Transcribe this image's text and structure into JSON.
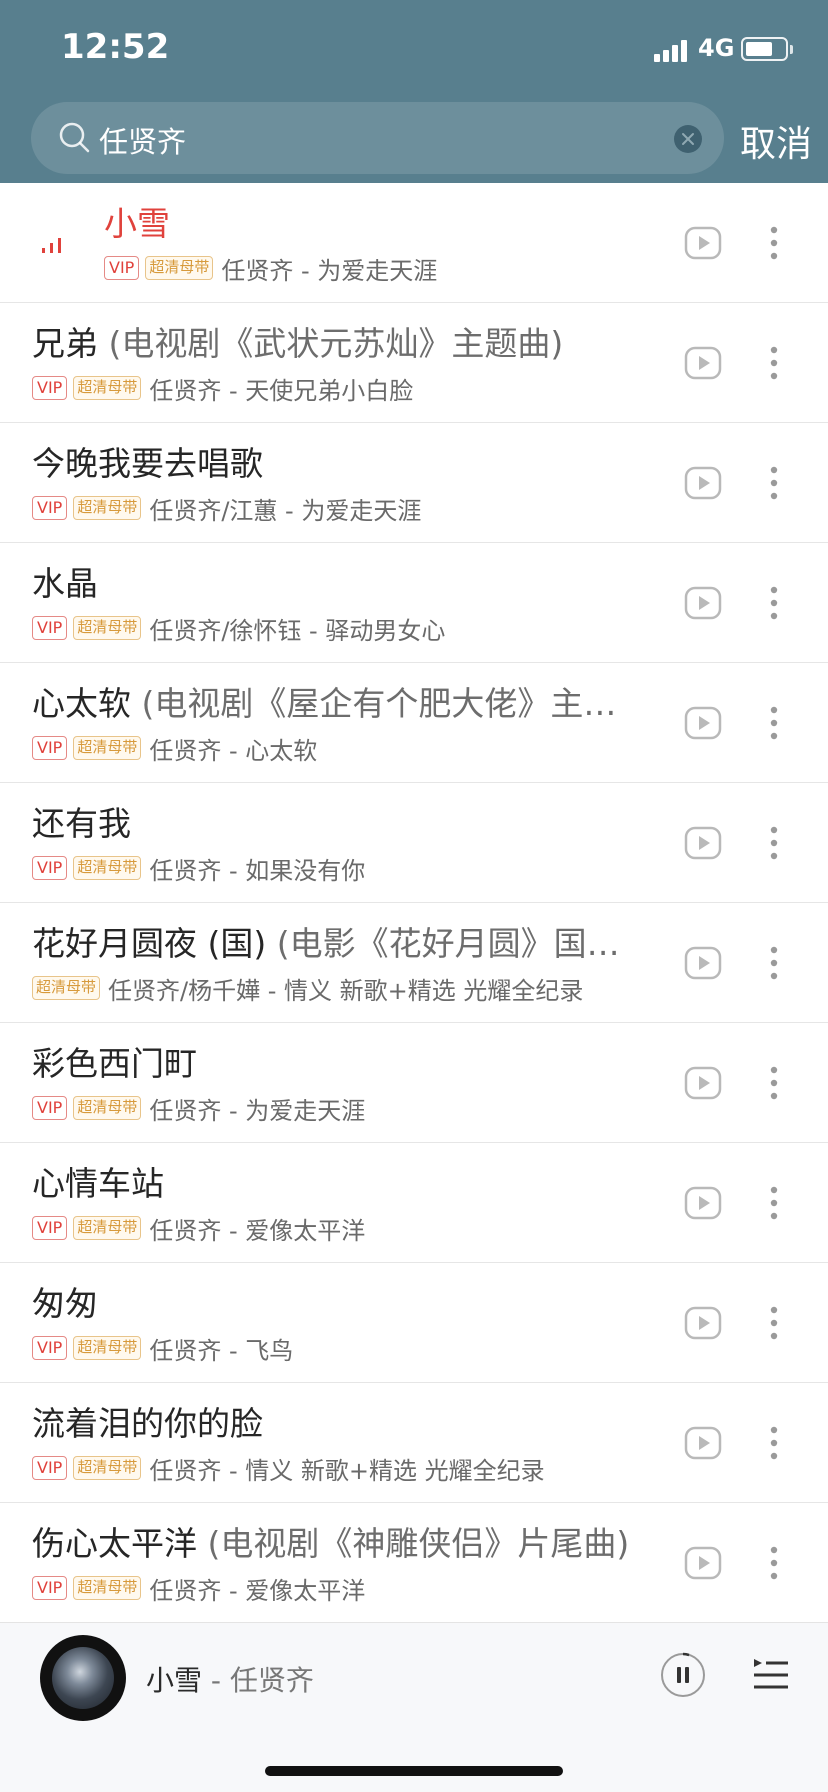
{
  "status": {
    "time": "12:52",
    "network": "4G"
  },
  "search": {
    "query": "任贤齐",
    "cancel_label": "取消"
  },
  "songs": [
    {
      "title": "小雪",
      "subtitle": "",
      "badges": [
        "VIP",
        "超清母带"
      ],
      "artist_album": "任贤齐 - 为爱走天涯",
      "playing": true
    },
    {
      "title": "兄弟",
      "subtitle": "(电视剧《武状元苏灿》主题曲)",
      "badges": [
        "VIP",
        "超清母带"
      ],
      "artist_album": "任贤齐 - 天使兄弟小白脸",
      "playing": false
    },
    {
      "title": "今晚我要去唱歌",
      "subtitle": "",
      "badges": [
        "VIP",
        "超清母带"
      ],
      "artist_album": "任贤齐/江蕙 - 为爱走天涯",
      "playing": false
    },
    {
      "title": "水晶",
      "subtitle": "",
      "badges": [
        "VIP",
        "超清母带"
      ],
      "artist_album": "任贤齐/徐怀钰 - 驿动男女心",
      "playing": false
    },
    {
      "title": "心太软",
      "subtitle": "(电视剧《屋企有个肥大佬》主…",
      "badges": [
        "VIP",
        "超清母带"
      ],
      "artist_album": "任贤齐 - 心太软",
      "playing": false
    },
    {
      "title": "还有我",
      "subtitle": "",
      "badges": [
        "VIP",
        "超清母带"
      ],
      "artist_album": "任贤齐 - 如果没有你",
      "playing": false
    },
    {
      "title": "花好月圆夜 (国)",
      "subtitle": "(电影《花好月圆》国…",
      "badges": [
        "超清母带"
      ],
      "artist_album": "任贤齐/杨千嬅 - 情义 新歌+精选 光耀全纪录",
      "playing": false
    },
    {
      "title": "彩色西门町",
      "subtitle": "",
      "badges": [
        "VIP",
        "超清母带"
      ],
      "artist_album": "任贤齐 - 为爱走天涯",
      "playing": false
    },
    {
      "title": "心情车站",
      "subtitle": "",
      "badges": [
        "VIP",
        "超清母带"
      ],
      "artist_album": "任贤齐 - 爱像太平洋",
      "playing": false
    },
    {
      "title": "匆匆",
      "subtitle": "",
      "badges": [
        "VIP",
        "超清母带"
      ],
      "artist_album": "任贤齐 - 飞鸟",
      "playing": false
    },
    {
      "title": "流着泪的你的脸",
      "subtitle": "",
      "badges": [
        "VIP",
        "超清母带"
      ],
      "artist_album": "任贤齐 - 情义 新歌+精选 光耀全纪录",
      "playing": false
    },
    {
      "title": "伤心太平洋",
      "subtitle": "(电视剧《神雕侠侣》片尾曲)",
      "badges": [
        "VIP",
        "超清母带"
      ],
      "artist_album": "任贤齐 - 爱像太平洋",
      "playing": false
    }
  ],
  "player": {
    "title": "小雪",
    "separator": " - ",
    "artist": "任贤齐"
  },
  "colors": {
    "header": "#587f8e",
    "accent_red": "#e0423c",
    "hq_gold": "#d79a3c"
  }
}
